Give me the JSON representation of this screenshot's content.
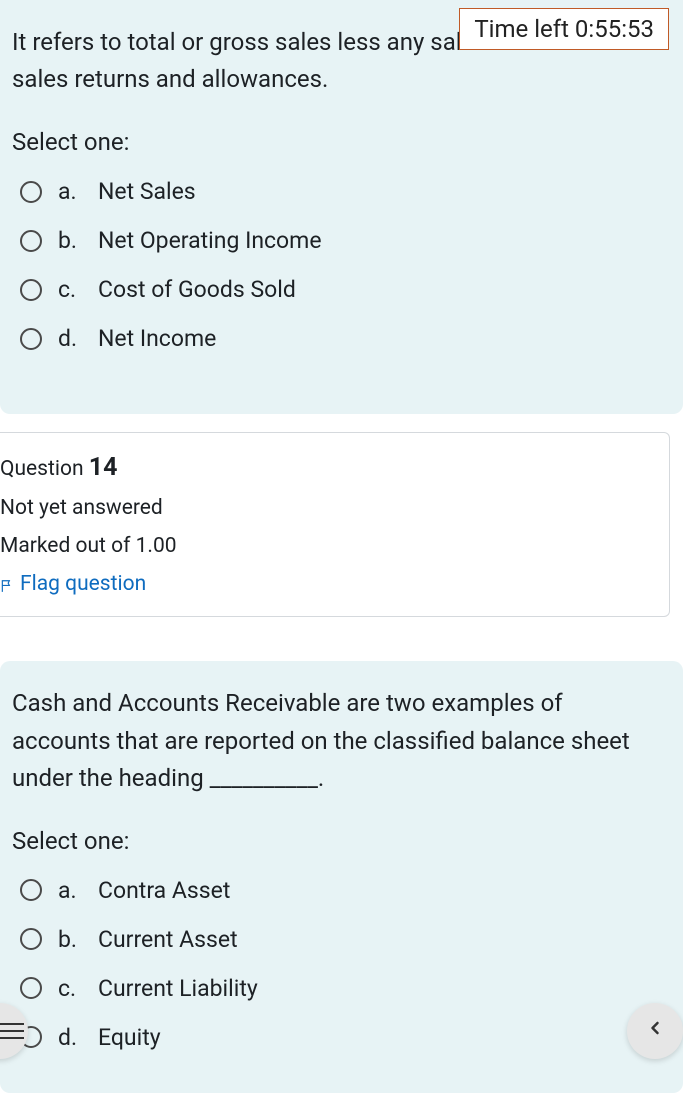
{
  "timer": {
    "text": "Time left 0:55:53"
  },
  "q13": {
    "prompt": "It refers to total or gross sales less any sales discounts and sales returns and allowances.",
    "select_one": "Select one:",
    "options": [
      {
        "letter": "a.",
        "text": "Net Sales"
      },
      {
        "letter": "b.",
        "text": "Net Operating Income"
      },
      {
        "letter": "c.",
        "text": "Cost of Goods Sold"
      },
      {
        "letter": "d.",
        "text": "Net Income"
      }
    ]
  },
  "qinfo": {
    "label": "Question",
    "number": "14",
    "status": "Not yet answered",
    "marks": "Marked out of 1.00",
    "flag": "Flag question"
  },
  "q14": {
    "prompt": "Cash and Accounts Receivable are two examples of accounts that are reported on the classified balance sheet under the heading __________.",
    "select_one": "Select one:",
    "options": [
      {
        "letter": "a.",
        "text": "Contra Asset"
      },
      {
        "letter": "b.",
        "text": "Current Asset"
      },
      {
        "letter": "c.",
        "text": "Current Liability"
      },
      {
        "letter": "d.",
        "text": "Equity"
      }
    ]
  }
}
